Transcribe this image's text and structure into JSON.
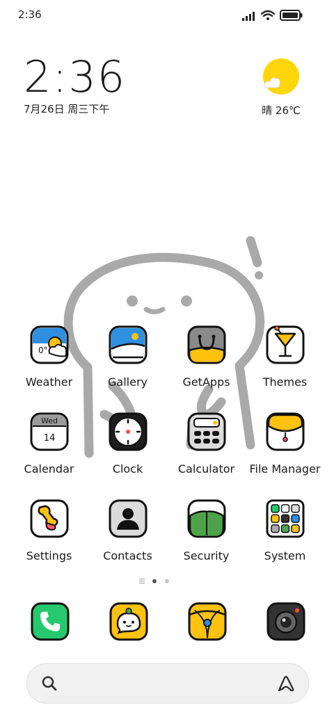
{
  "status": {
    "time": "2:36"
  },
  "clock": {
    "time": "2:36",
    "date": "7月26日 周三下午"
  },
  "weather": {
    "text": "晴 26℃"
  },
  "apps": {
    "weather": "Weather",
    "gallery": "Gallery",
    "getapps": "GetApps",
    "themes": "Themes",
    "calendar": "Calendar",
    "calendar_day": "Wed",
    "calendar_date": "14",
    "clock": "Clock",
    "calculator": "Calculator",
    "file_manager": "File Manager",
    "settings": "Settings",
    "contacts": "Contacts",
    "security": "Security",
    "system": "System"
  },
  "weather_icon_temp": "0°",
  "dock": [
    "phone-icon",
    "messages-icon",
    "browser-icon",
    "camera-icon"
  ],
  "colors": {
    "accent_yellow": "#ffc20e",
    "phone_green": "#26c96f",
    "sky_blue": "#2f8fe0"
  }
}
